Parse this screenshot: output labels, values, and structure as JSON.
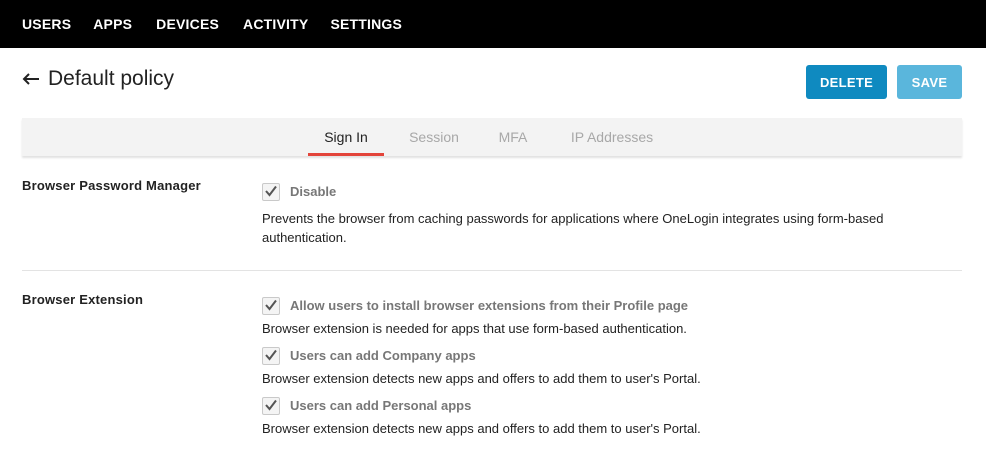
{
  "topnav": {
    "items": [
      "USERS",
      "APPS",
      "DEVICES",
      "ACTIVITY",
      "SETTINGS"
    ]
  },
  "header": {
    "back_icon": "left-arrow-icon",
    "title": "Default policy",
    "delete_label": "DELETE",
    "save_label": "SAVE"
  },
  "tabs": [
    {
      "label": "Sign In",
      "active": true
    },
    {
      "label": "Session",
      "active": false
    },
    {
      "label": "MFA",
      "active": false
    },
    {
      "label": "IP Addresses",
      "active": false
    }
  ],
  "sections": {
    "password_manager": {
      "label": "Browser Password Manager",
      "options": [
        {
          "checked": true,
          "label": "Disable",
          "description": "Prevents the browser from caching passwords for applications where OneLogin integrates using form-based authentication."
        }
      ]
    },
    "browser_extension": {
      "label": "Browser Extension",
      "options": [
        {
          "checked": true,
          "label": "Allow users to install browser extensions from their Profile page",
          "description": "Browser extension is needed for apps that use form-based authentication."
        },
        {
          "checked": true,
          "label": "Users can add Company apps",
          "description": "Browser extension detects new apps and offers to add them to user's Portal."
        },
        {
          "checked": true,
          "label": "Users can add Personal apps",
          "description": "Browser extension detects new apps and offers to add them to user's Portal."
        }
      ]
    }
  },
  "colors": {
    "nav_bg": "#000000",
    "delete_btn": "#0f8ac0",
    "save_btn": "#5ab6dc",
    "tab_active_underline": "#e3443a"
  }
}
